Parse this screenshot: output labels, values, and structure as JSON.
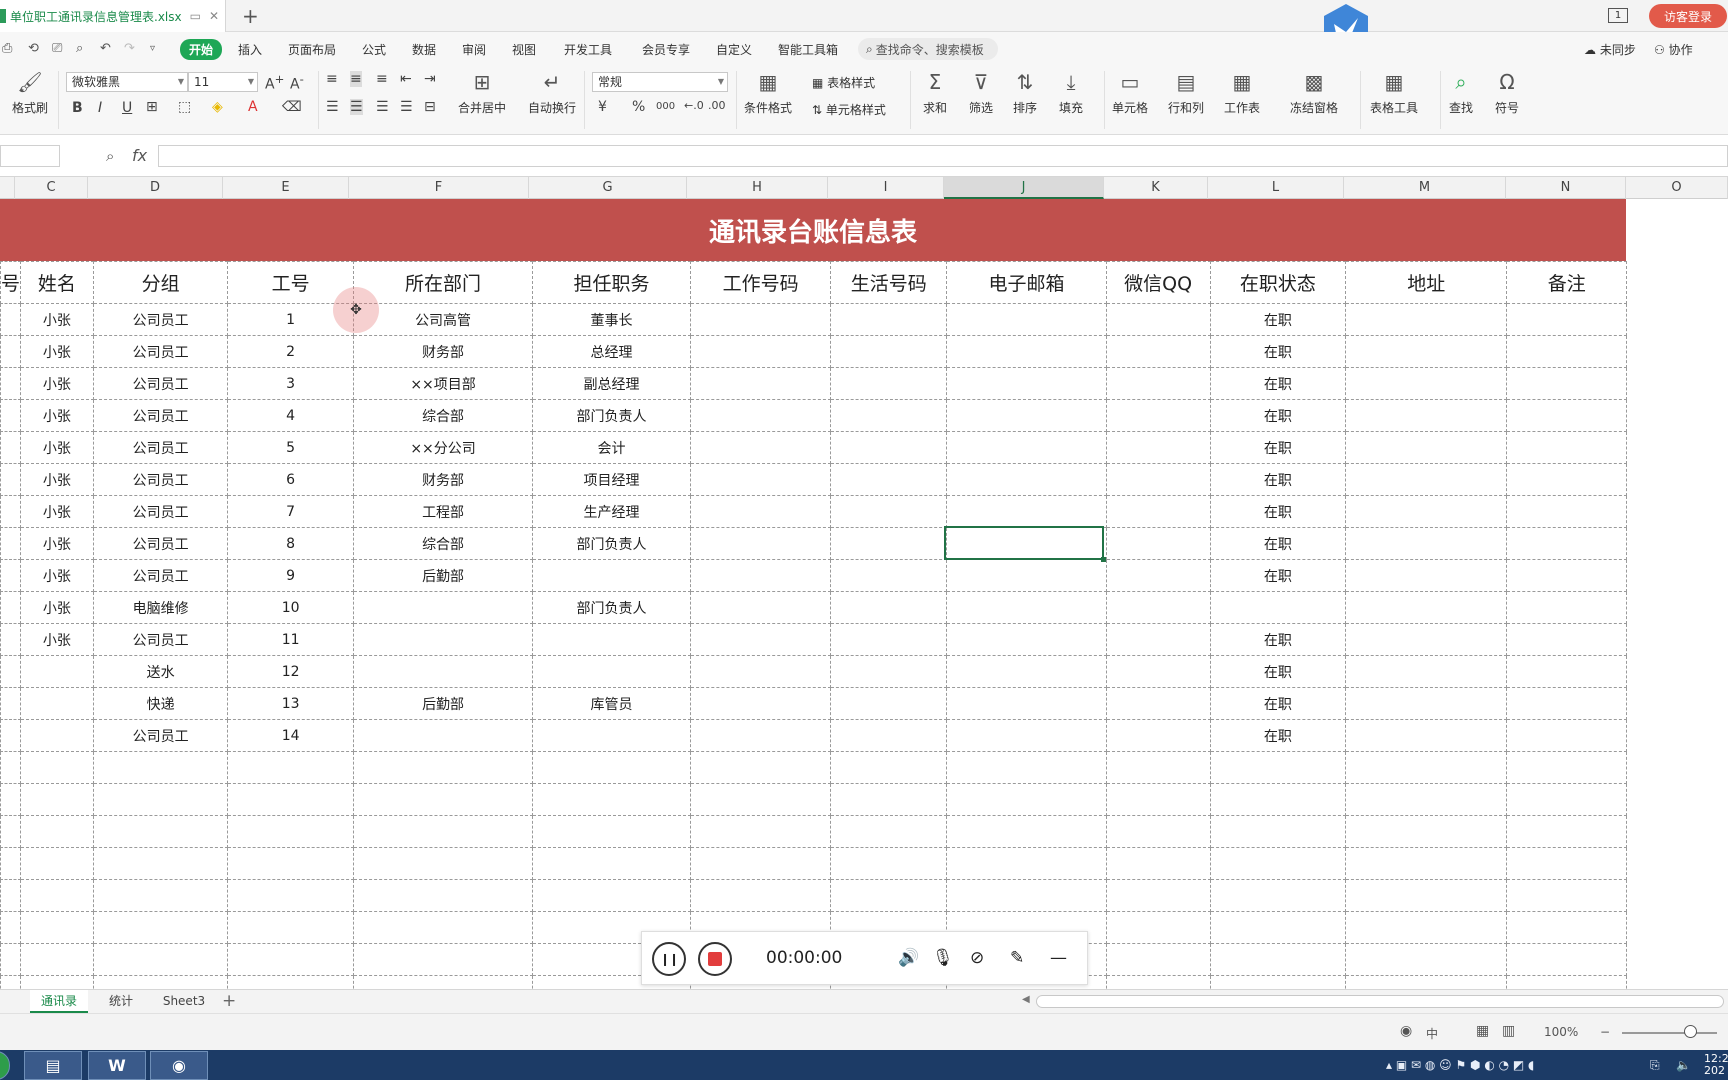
{
  "titlebar": {
    "doc_title": "单位职工通讯录信息管理表.xlsx",
    "new_tab": "+",
    "page_indicator": "1",
    "login_label": "访客登录"
  },
  "menu": {
    "items": [
      "开始",
      "插入",
      "页面布局",
      "公式",
      "数据",
      "审阅",
      "视图",
      "开发工具",
      "会员专享",
      "自定义",
      "智能工具箱"
    ],
    "search_placeholder": "查找命令、搜索模板",
    "sync_label": "未同步",
    "collab_label": "协作"
  },
  "ribbon": {
    "format_painter": "格式刷",
    "font_name": "微软雅黑",
    "font_size": "11",
    "bold": "B",
    "italic": "I",
    "underline": "U",
    "merge_center": "合并居中",
    "wrap_text": "自动换行",
    "number_format": "常规",
    "currency": "¥",
    "percent": "%",
    "thousands": "000",
    "cond_format": "条件格式",
    "table_style": "表格样式",
    "cell_style": "单元格样式",
    "sum": "求和",
    "filter": "筛选",
    "sort": "排序",
    "fill": "填充",
    "cells": "单元格",
    "row_col": "行和列",
    "worksheet": "工作表",
    "freeze": "冻结窗格",
    "table_tools": "表格工具",
    "find": "查找",
    "symbol": "符号"
  },
  "formula": {
    "fx": "fx",
    "value": ""
  },
  "columns": [
    "C",
    "D",
    "E",
    "F",
    "G",
    "H",
    "I",
    "J",
    "K",
    "L",
    "M",
    "N",
    "O"
  ],
  "selected_column": "J",
  "sheet": {
    "title": "通讯录台账信息表",
    "headers": [
      "号",
      "姓名",
      "分组",
      "工号",
      "所在部门",
      "担任职务",
      "工作号码",
      "生活号码",
      "电子邮箱",
      "微信QQ",
      "在职状态",
      "地址",
      "备注"
    ],
    "rows": [
      [
        "",
        "小张",
        "公司员工",
        "1",
        "公司高管",
        "董事长",
        "",
        "",
        "",
        "",
        "在职",
        "",
        ""
      ],
      [
        "",
        "小张",
        "公司员工",
        "2",
        "财务部",
        "总经理",
        "",
        "",
        "",
        "",
        "在职",
        "",
        ""
      ],
      [
        "",
        "小张",
        "公司员工",
        "3",
        "××项目部",
        "副总经理",
        "",
        "",
        "",
        "",
        "在职",
        "",
        ""
      ],
      [
        "",
        "小张",
        "公司员工",
        "4",
        "综合部",
        "部门负责人",
        "",
        "",
        "",
        "",
        "在职",
        "",
        ""
      ],
      [
        "",
        "小张",
        "公司员工",
        "5",
        "××分公司",
        "会计",
        "",
        "",
        "",
        "",
        "在职",
        "",
        ""
      ],
      [
        "",
        "小张",
        "公司员工",
        "6",
        "财务部",
        "项目经理",
        "",
        "",
        "",
        "",
        "在职",
        "",
        ""
      ],
      [
        "",
        "小张",
        "公司员工",
        "7",
        "工程部",
        "生产经理",
        "",
        "",
        "",
        "",
        "在职",
        "",
        ""
      ],
      [
        "",
        "小张",
        "公司员工",
        "8",
        "综合部",
        "部门负责人",
        "",
        "",
        "",
        "",
        "在职",
        "",
        ""
      ],
      [
        "",
        "小张",
        "公司员工",
        "9",
        "后勤部",
        "",
        "",
        "",
        "",
        "",
        "在职",
        "",
        ""
      ],
      [
        "",
        "小张",
        "电脑维修",
        "10",
        "",
        "部门负责人",
        "",
        "",
        "",
        "",
        "",
        "",
        ""
      ],
      [
        "",
        "小张",
        "公司员工",
        "11",
        "",
        "",
        "",
        "",
        "",
        "",
        "在职",
        "",
        ""
      ],
      [
        "",
        "",
        "送水",
        "12",
        "",
        "",
        "",
        "",
        "",
        "",
        "在职",
        "",
        ""
      ],
      [
        "",
        "",
        "快递",
        "13",
        "后勤部",
        "库管员",
        "",
        "",
        "",
        "",
        "在职",
        "",
        ""
      ],
      [
        "",
        "",
        "公司员工",
        "14",
        "",
        "",
        "",
        "",
        "",
        "",
        "在职",
        "",
        ""
      ],
      [
        "",
        "",
        "",
        "",
        "",
        "",
        "",
        "",
        "",
        "",
        "",
        "",
        ""
      ],
      [
        "",
        "",
        "",
        "",
        "",
        "",
        "",
        "",
        "",
        "",
        "",
        "",
        ""
      ],
      [
        "",
        "",
        "",
        "",
        "",
        "",
        "",
        "",
        "",
        "",
        "",
        "",
        ""
      ],
      [
        "",
        "",
        "",
        "",
        "",
        "",
        "",
        "",
        "",
        "",
        "",
        "",
        ""
      ],
      [
        "",
        "",
        "",
        "",
        "",
        "",
        "",
        "",
        "",
        "",
        "",
        "",
        ""
      ],
      [
        "",
        "",
        "",
        "",
        "",
        "",
        "",
        "",
        "",
        "",
        "",
        "",
        ""
      ],
      [
        "",
        "",
        "",
        "",
        "",
        "",
        "",
        "",
        "",
        "",
        "",
        "",
        ""
      ],
      [
        "",
        "",
        "",
        "",
        "",
        "",
        "",
        "",
        "",
        "",
        "",
        "",
        ""
      ]
    ]
  },
  "recorder": {
    "time": "00:00:00"
  },
  "sheet_tabs": [
    "通讯录",
    "统计",
    "Sheet3"
  ],
  "active_sheet": "通讯录",
  "status": {
    "input_mode": "中",
    "zoom": "100%"
  },
  "taskbar": {
    "clock_time": "12:2",
    "clock_date": "202"
  },
  "colors": {
    "title_band": "#c0504d",
    "accent_green": "#1ea756",
    "selection": "#217346"
  }
}
